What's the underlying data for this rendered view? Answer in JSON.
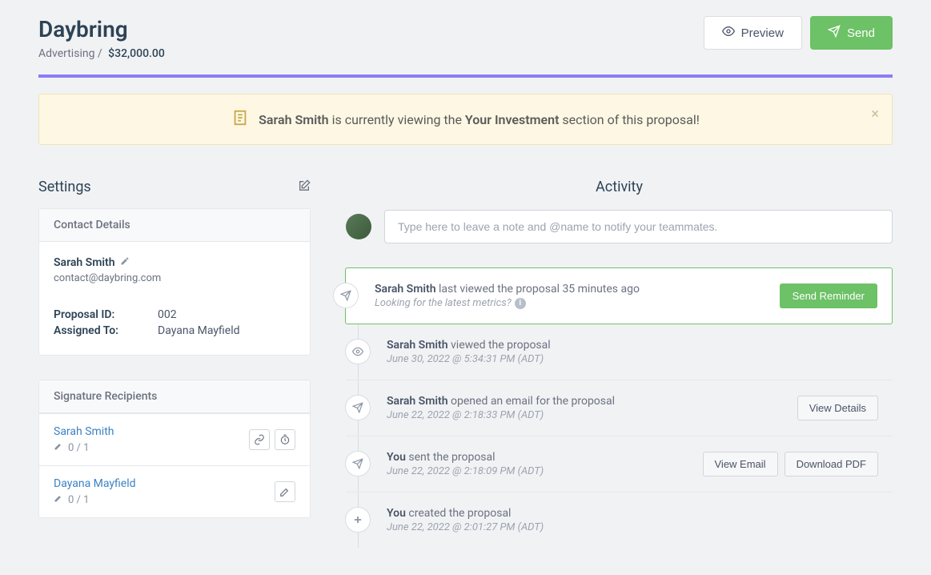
{
  "header": {
    "title": "Daybring",
    "category": "Advertising",
    "amount": "$32,000.00",
    "preview_label": "Preview",
    "send_label": "Send"
  },
  "alert": {
    "viewer": "Sarah Smith",
    "mid1": " is currently viewing the ",
    "section": "Your Investment",
    "mid2": " section of this proposal!"
  },
  "settings": {
    "title": "Settings",
    "contact_header": "Contact Details",
    "contact_name": "Sarah Smith",
    "contact_email": "contact@daybring.com",
    "proposal_id_label": "Proposal ID:",
    "proposal_id": "002",
    "assigned_label": "Assigned To:",
    "assigned_to": "Dayana Mayfield",
    "sig_header": "Signature Recipients",
    "recipients": [
      {
        "name": "Sarah Smith",
        "signed": "0 / 1"
      },
      {
        "name": "Dayana Mayfield",
        "signed": "0 / 1"
      }
    ]
  },
  "activity": {
    "title": "Activity",
    "note_placeholder": "Type here to leave a note and @name to notify your teammates.",
    "reminder_label": "Send Reminder",
    "view_details_label": "View Details",
    "view_email_label": "View Email",
    "download_pdf_label": "Download PDF",
    "items": [
      {
        "actor": "Sarah Smith",
        "text": " last viewed the proposal 35 minutes ago",
        "sub": "Looking for the latest metrics?"
      },
      {
        "actor": "Sarah Smith",
        "text": " viewed the proposal",
        "sub": "June 30, 2022 @ 5:34:31 PM (ADT)"
      },
      {
        "actor": "Sarah Smith",
        "text": " opened an email for the proposal",
        "sub": "June 22, 2022 @ 2:18:33 PM (ADT)"
      },
      {
        "actor": "You",
        "text": " sent the proposal",
        "sub": "June 22, 2022 @ 2:18:09 PM (ADT)"
      },
      {
        "actor": "You",
        "text": " created the proposal",
        "sub": "June 22, 2022 @ 2:01:27 PM (ADT)"
      }
    ]
  }
}
